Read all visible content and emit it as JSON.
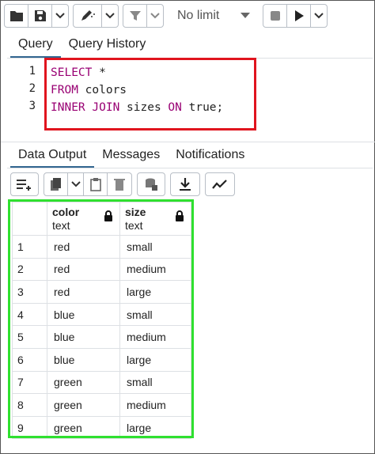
{
  "toolbar": {
    "limit_label": "No limit",
    "icons": [
      "folder-icon",
      "save-icon",
      "chevron-down-icon",
      "edit-icon",
      "chevron-down-icon",
      "filter-icon",
      "chevron-down-icon",
      "stop-icon",
      "play-icon",
      "chevron-down-icon"
    ]
  },
  "query_tabs": [
    "Query",
    "Query History"
  ],
  "editor": {
    "line_numbers": [
      "1",
      "2",
      "3"
    ],
    "lines": [
      {
        "kw1": "SELECT",
        "rest1": " *",
        "kw2": "",
        "rest2": "",
        "kw3": "",
        "rest3": ""
      },
      {
        "kw1": "FROM",
        "rest1": " colors",
        "kw2": "",
        "rest2": "",
        "kw3": "",
        "rest3": ""
      },
      {
        "kw1": "INNER JOIN",
        "rest1": " sizes ",
        "kw2": "ON",
        "rest2": " true;",
        "kw3": "",
        "rest3": ""
      }
    ]
  },
  "result_tabs": [
    "Data Output",
    "Messages",
    "Notifications"
  ],
  "grid": {
    "columns": [
      {
        "name": "color",
        "type": "text"
      },
      {
        "name": "size",
        "type": "text"
      }
    ],
    "rows": [
      {
        "n": "1",
        "color": "red",
        "size": "small"
      },
      {
        "n": "2",
        "color": "red",
        "size": "medium"
      },
      {
        "n": "3",
        "color": "red",
        "size": "large"
      },
      {
        "n": "4",
        "color": "blue",
        "size": "small"
      },
      {
        "n": "5",
        "color": "blue",
        "size": "medium"
      },
      {
        "n": "6",
        "color": "blue",
        "size": "large"
      },
      {
        "n": "7",
        "color": "green",
        "size": "small"
      },
      {
        "n": "8",
        "color": "green",
        "size": "medium"
      },
      {
        "n": "9",
        "color": "green",
        "size": "large"
      }
    ]
  },
  "colors": {
    "keyword": "#990073",
    "annotation_query": "#e0141e",
    "annotation_result": "#2fe02f",
    "active_tab": "#326690"
  }
}
